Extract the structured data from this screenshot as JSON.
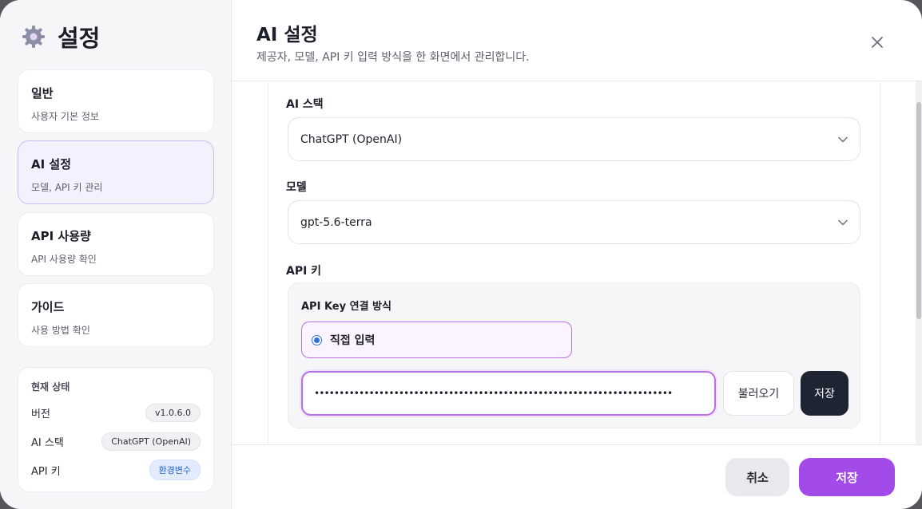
{
  "sidebar": {
    "title": "설정",
    "items": [
      {
        "title": "일반",
        "subtitle": "사용자 기본 정보"
      },
      {
        "title": "AI 설정",
        "subtitle": "모델, API 키 관리"
      },
      {
        "title": "API 사용량",
        "subtitle": "API 사용량 확인"
      },
      {
        "title": "가이드",
        "subtitle": "사용 방법 확인"
      }
    ],
    "status": {
      "heading": "현재 상태",
      "rows": [
        {
          "key": "버전",
          "value": "v1.0.6.0"
        },
        {
          "key": "AI 스택",
          "value": "ChatGPT (OpenAI)"
        },
        {
          "key": "API 키",
          "value": "환경변수"
        }
      ]
    }
  },
  "header": {
    "title": "AI 설정",
    "subtitle": "제공자, 모델, API 키 입력 방식을 한 화면에서 관리합니다."
  },
  "form": {
    "ai_stack_label": "AI 스택",
    "ai_stack_value": "ChatGPT (OpenAI)",
    "model_label": "모델",
    "model_value": "gpt-5.6-terra",
    "api_key_label": "API 키",
    "connection_label": "API Key 연결 방식",
    "radio_direct_label": "직접 입력",
    "api_key_value": "••••••••••••••••••••••••••••••••••••••••••••••••••••••••••••••••••••••••",
    "load_button": "불러오기",
    "save_key_button": "저장"
  },
  "footer": {
    "cancel": "취소",
    "save": "저장"
  },
  "colors": {
    "accent": "#a24be8",
    "dark_button": "#1f2432",
    "badge_blue": "#2563c9"
  }
}
